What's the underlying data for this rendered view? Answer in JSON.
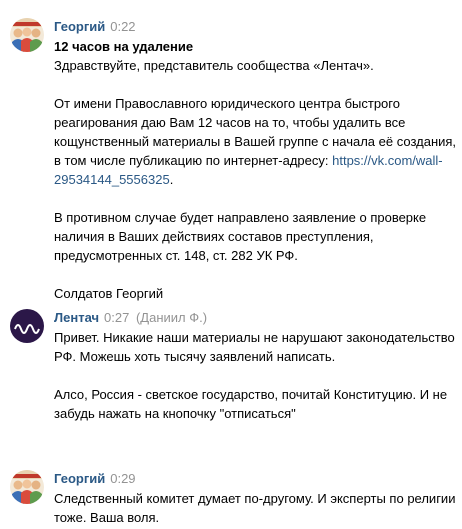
{
  "messages": [
    {
      "author": "Георгий",
      "time": "0:22",
      "avatar_icon": "cartoon-group-avatar",
      "subject": "12 часов на удаление",
      "greeting": "Здравствуйте, представитель сообщества «Лентач».",
      "paragraph_1": "От имени Православного юридического центра быстрого реагирования даю Вам 12 часов на то, чтобы удалить все кощунственный материалы в Вашей группе с начала её создания, в том числе публикацию по интернет-адресу:",
      "link": "https://vk.com/wall-29534144_5556325",
      "link_suffix": ".",
      "paragraph_2": "В противном случае будет направлено заявление о проверке наличия в Ваших действиях составов преступления, предусмотренных ст. 148, ст. 282 УК РФ.",
      "signature": "Солдатов Георгий"
    },
    {
      "author": "Лентач",
      "time": "0:27",
      "sender_note": "(Даниил Ф.)",
      "avatar_icon": "lentach-wave-logo",
      "paragraph_1": "Привет. Никакие наши материалы не нарушают законодательство РФ. Можешь хоть тысячу заявлений написать.",
      "paragraph_2": "Алсо, Россия - светское государство, почитай Конституцию. И не забудь нажать на кнопочку \"отписаться\""
    },
    {
      "author": "Георгий",
      "time": "0:29",
      "avatar_icon": "cartoon-group-avatar",
      "paragraph_1": "Следственный комитет думает по-другому. И эксперты по религии тоже. Ваша воля."
    }
  ],
  "colors": {
    "author": "#2a5885",
    "time": "#939393",
    "text": "#000000",
    "lentach_avatar_bg": "#2b1748"
  }
}
